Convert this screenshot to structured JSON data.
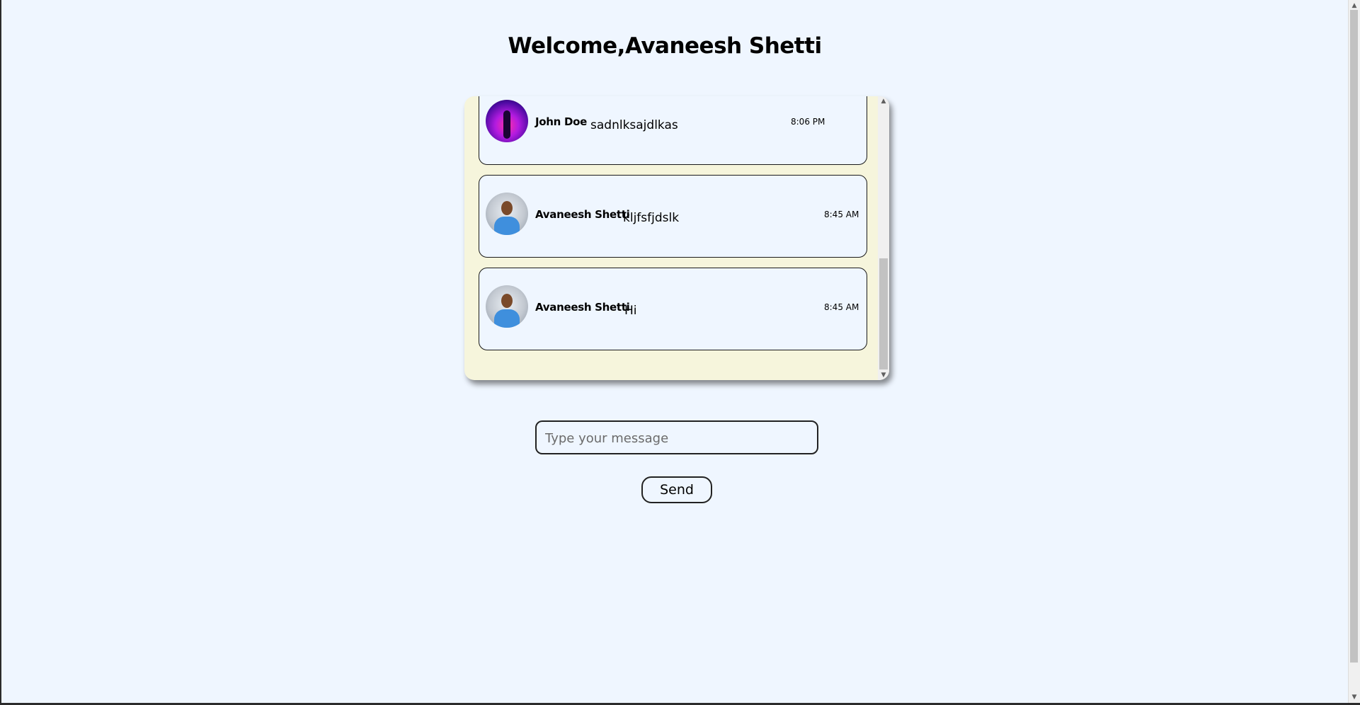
{
  "header": {
    "title": "Welcome,Avaneesh Shetti"
  },
  "messages": [
    {
      "sender": "John Doe",
      "text": "sadnlksajdlkas",
      "time": "8:06 PM",
      "avatar": "purple-abstract-avatar"
    },
    {
      "sender": "Avaneesh Shetti",
      "text": "kljfsfjdslk",
      "time": "8:45 AM",
      "avatar": "person-photo-avatar"
    },
    {
      "sender": "Avaneesh Shetti",
      "text": "Hi",
      "time": "8:45 AM",
      "avatar": "person-photo-avatar"
    }
  ],
  "composer": {
    "placeholder": "Type your message",
    "value": "",
    "send_label": "Send"
  },
  "colors": {
    "page_background": "#eff6ff",
    "chat_panel_background": "#f6f5dc",
    "message_card_background": "#eff6ff",
    "border": "#1a1a1a"
  },
  "icons": {
    "scroll_up": "▲",
    "scroll_down": "▼"
  }
}
